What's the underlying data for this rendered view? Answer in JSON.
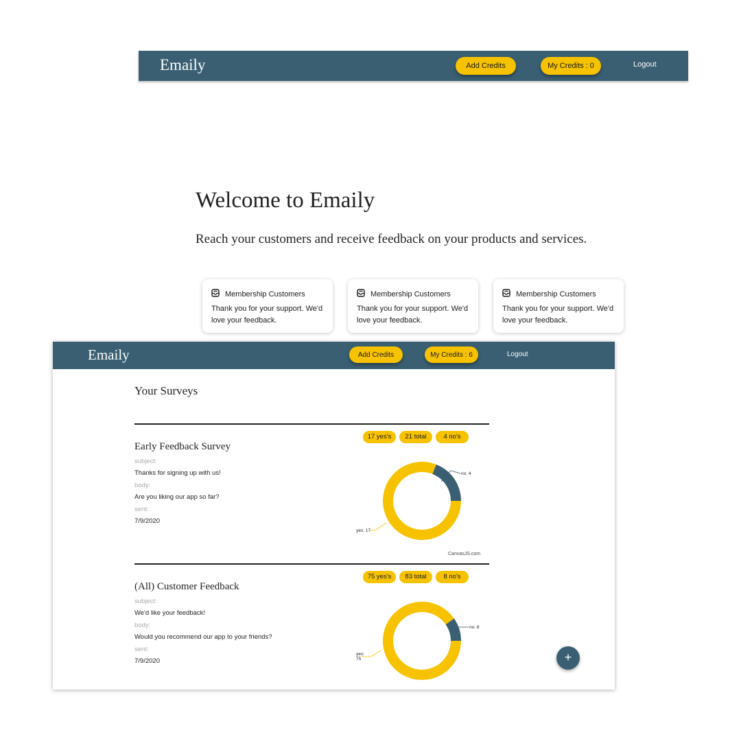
{
  "brand": "Emaily",
  "nav_top": {
    "add_credits_label": "Add Credits",
    "my_credits_label": "My Credits : 0",
    "logout_label": "Logout"
  },
  "landing": {
    "title": "Welcome to Emaily",
    "subtitle": "Reach your customers and receive feedback on your products and services.",
    "cards": [
      {
        "icon": "inbox-icon",
        "title": "Membership Customers",
        "body": "Thank you for your support. We'd love your feedback."
      },
      {
        "icon": "inbox-icon",
        "title": "Membership Customers",
        "body": "Thank you for your support. We'd love your feedback."
      },
      {
        "icon": "inbox-icon",
        "title": "Membership Customers",
        "body": "Thank you for your support. We'd love your feedback."
      }
    ]
  },
  "nav_bottom": {
    "add_credits_label": "Add Credits",
    "my_credits_label": "My Credits : 6",
    "logout_label": "Logout"
  },
  "dashboard": {
    "heading": "Your Surveys",
    "fab_label": "+",
    "chart_credit": "CanvasJS.com",
    "surveys": [
      {
        "title": "Early Feedback Survey",
        "subject_label": "subject:",
        "subject": "Thanks for signing up with us!",
        "body_label": "body:",
        "body": "Are you liking our app so far?",
        "sent_label": "sent:",
        "sent": "7/9/2020",
        "yes_badge": "17 yes's",
        "total_badge": "21 total",
        "no_badge": "4 no's",
        "no_label": "no: 4",
        "yes_label_line1": "yes: 17",
        "yes_label_line2": ""
      },
      {
        "title": "(All) Customer Feedback",
        "subject_label": "subject:",
        "subject": "We'd like your feedback!",
        "body_label": "body:",
        "body": "Would you recommend our app to your friends?",
        "sent_label": "sent:",
        "sent": "7/9/2020",
        "yes_badge": "75 yes's",
        "total_badge": "83 total",
        "no_badge": "8 no's",
        "no_label": "no: 8",
        "yes_label_line1": "yes:",
        "yes_label_line2": "75"
      }
    ]
  },
  "colors": {
    "nav": "#3a5f72",
    "accent": "#f7c200",
    "no_slice": "#3a5f72",
    "yes_slice": "#f7c200"
  },
  "chart_data": [
    {
      "type": "pie",
      "style": "doughnut",
      "categories": [
        "yes",
        "no"
      ],
      "values": [
        17,
        4
      ],
      "colors": [
        "#f7c200",
        "#3a5f72"
      ],
      "labels": [
        "yes: 17",
        "no: 4"
      ]
    },
    {
      "type": "pie",
      "style": "doughnut",
      "categories": [
        "yes",
        "no"
      ],
      "values": [
        75,
        8
      ],
      "colors": [
        "#f7c200",
        "#3a5f72"
      ],
      "labels": [
        "yes: 75",
        "no: 8"
      ]
    }
  ]
}
